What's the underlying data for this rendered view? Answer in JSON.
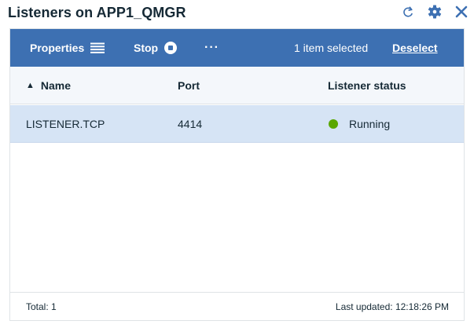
{
  "title": "Listeners on APP1_QMGR",
  "header_icons": [
    "refresh-icon",
    "gear-icon",
    "close-icon"
  ],
  "colors": {
    "accent": "#3d70b2",
    "selected_row": "#d6e4f5",
    "status_running": "#5aa700"
  },
  "toolbar": {
    "properties_label": "Properties",
    "stop_label": "Stop",
    "more_label": "···",
    "selected_text": "1 item selected",
    "deselect_label": "Deselect"
  },
  "table": {
    "sort_indicator": "▲",
    "columns": [
      "Name",
      "Port",
      "Listener status"
    ],
    "rows": [
      {
        "name": "LISTENER.TCP",
        "port": "4414",
        "status": "Running",
        "selected": true
      }
    ]
  },
  "footer": {
    "total": "Total: 1",
    "last_updated": "Last updated: 12:18:26 PM"
  }
}
